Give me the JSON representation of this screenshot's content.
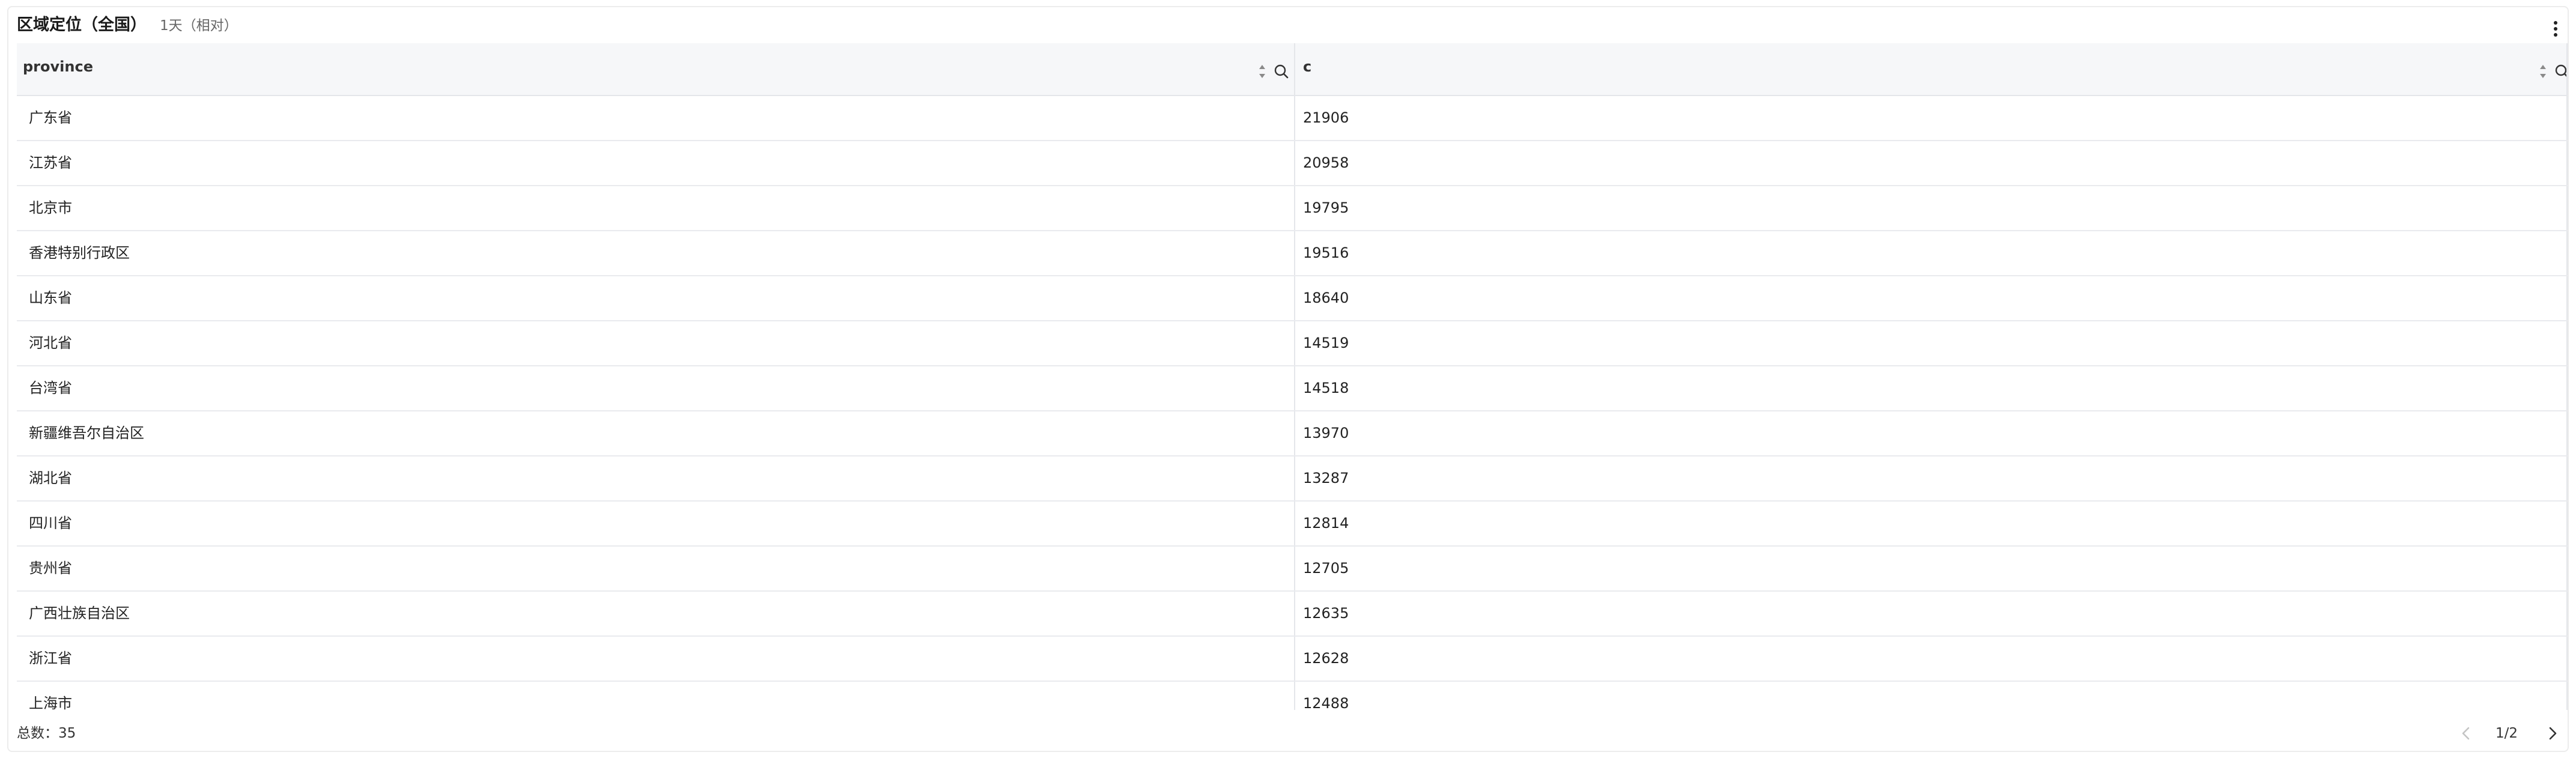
{
  "header": {
    "title": "区域定位（全国）",
    "subtitle": "1天（相对）",
    "more_icon": "more-vertical-icon"
  },
  "table": {
    "columns": [
      {
        "label": "province",
        "sort_icon": "sort-icon",
        "search_icon": "search-icon"
      },
      {
        "label": "c",
        "sort_icon": "sort-icon",
        "search_icon": "search-icon"
      }
    ],
    "rows": [
      {
        "province": "广东省",
        "c": "21906"
      },
      {
        "province": "江苏省",
        "c": "20958"
      },
      {
        "province": "北京市",
        "c": "19795"
      },
      {
        "province": "香港特别行政区",
        "c": "19516"
      },
      {
        "province": "山东省",
        "c": "18640"
      },
      {
        "province": "河北省",
        "c": "14519"
      },
      {
        "province": "台湾省",
        "c": "14518"
      },
      {
        "province": "新疆维吾尔自治区",
        "c": "13970"
      },
      {
        "province": "湖北省",
        "c": "13287"
      },
      {
        "province": "四川省",
        "c": "12814"
      },
      {
        "province": "贵州省",
        "c": "12705"
      },
      {
        "province": "广西壮族自治区",
        "c": "12635"
      },
      {
        "province": "浙江省",
        "c": "12628"
      },
      {
        "province": "上海市",
        "c": "12488"
      }
    ]
  },
  "footer": {
    "total": "总数：35",
    "page": "1/2",
    "prev_icon": "chevron-left-icon",
    "next_icon": "chevron-right-icon"
  }
}
